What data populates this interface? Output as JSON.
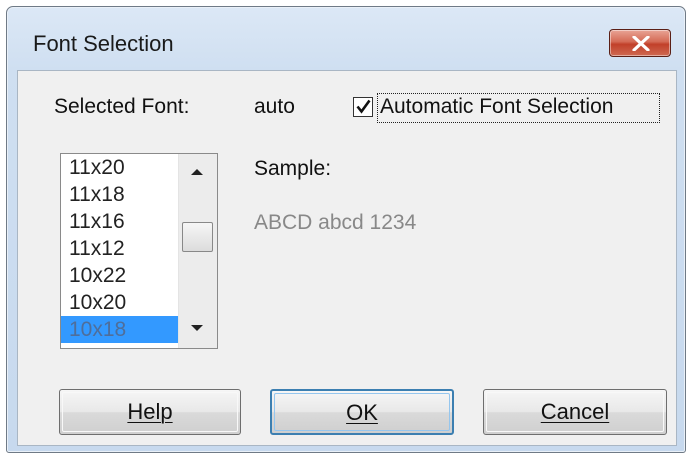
{
  "window": {
    "title": "Font Selection"
  },
  "selected_font": {
    "label": "Selected Font:",
    "value": "auto"
  },
  "automatic_selection": {
    "checked": true,
    "label": "Automatic Font Selection"
  },
  "font_list": {
    "items": [
      "11x20",
      "11x18",
      "11x16",
      "11x12",
      "10x22",
      "10x20",
      "10x18"
    ],
    "selected": "10x18"
  },
  "sample": {
    "label": "Sample:",
    "text": "ABCD abcd 1234"
  },
  "buttons": {
    "help": "Help",
    "ok": "OK",
    "cancel": "Cancel"
  },
  "icons": {
    "close": "close-icon",
    "check": "checkmark-icon",
    "scroll_up": "scroll-up-arrow-icon",
    "scroll_down": "scroll-down-arrow-icon"
  },
  "colors": {
    "selection": "#3399ff",
    "close_button": "#c1402a",
    "sample_text": "#888888"
  }
}
